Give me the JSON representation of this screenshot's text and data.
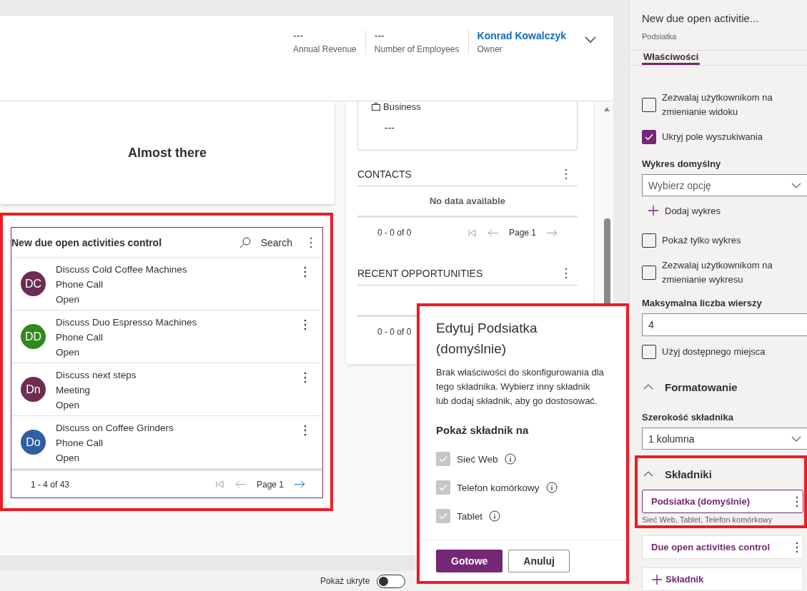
{
  "header": {
    "fields": [
      {
        "value": "---",
        "label": "Annual Revenue",
        "kind": "text"
      },
      {
        "value": "---",
        "label": "Number of Employees",
        "kind": "text"
      },
      {
        "value": "Konrad Kowalczyk",
        "label": "Owner",
        "kind": "link"
      }
    ]
  },
  "left_card": {
    "title": "Almost there"
  },
  "subgrid": {
    "title": "New due open activities control",
    "search_label": "Search",
    "rows": [
      {
        "initials": "DC",
        "color": "#6b2d52",
        "title": "Discuss Cold Coffee Machines",
        "type": "Phone Call",
        "status": "Open"
      },
      {
        "initials": "DD",
        "color": "#2f8a1d",
        "title": "Discuss Duo Espresso Machines",
        "type": "Phone Call",
        "status": "Open"
      },
      {
        "initials": "Dn",
        "color": "#6b2d52",
        "title": "Discuss next steps",
        "type": "Meeting",
        "status": "Open"
      },
      {
        "initials": "Do",
        "color": "#2e5fa3",
        "title": "Discuss on Coffee Grinders",
        "type": "Phone Call",
        "status": "Open"
      }
    ],
    "record_count": "1 - 4 of 43",
    "page": "Page 1"
  },
  "business_card": {
    "label": "Business",
    "value": "---"
  },
  "contacts": {
    "title": "CONTACTS",
    "empty_text": "No data available",
    "record_count": "0 - 0 of 0",
    "page": "Page 1"
  },
  "recent_opportunities": {
    "title": "RECENT OPPORTUNITIES",
    "record_count": "0 - 0 of 0"
  },
  "footer": {
    "toggle_label": "Pokaż ukryte",
    "toggle_on": false
  },
  "dialog": {
    "title": "Edytuj Podsiatka (domyślnie)",
    "description": "Brak właściwości do skonfigurowania dla tego składnika. Wybierz inny składnik lub dodaj składnik, aby go dostosować.",
    "section": "Pokaż składnik na",
    "options": [
      {
        "label": "Sieć Web",
        "checked": true,
        "disabled": true
      },
      {
        "label": "Telefon komórkowy",
        "checked": true,
        "disabled": true
      },
      {
        "label": "Tablet",
        "checked": true,
        "disabled": true
      }
    ],
    "buttons": [
      {
        "label": "Gotowe",
        "kind": "primary"
      },
      {
        "label": "Anuluj",
        "kind": "secondary"
      }
    ]
  },
  "panel": {
    "title": "New due open activitie...",
    "subtitle": "Podsiatka",
    "tabs": [
      {
        "label": "Właściwości",
        "selected": true
      }
    ],
    "settings": [
      {
        "kind": "checkbox",
        "label": "Zezwalaj użytkownikom na zmienianie widoku",
        "checked": false
      },
      {
        "kind": "checkbox",
        "label": "Ukryj pole wyszukiwania",
        "checked": true
      },
      {
        "kind": "select",
        "label": "Wykres domyślny",
        "placeholder": "Wybierz opcję"
      },
      {
        "kind": "add",
        "label": "Dodaj wykres"
      },
      {
        "kind": "checkbox",
        "label": "Pokaż tylko wykres",
        "checked": false
      },
      {
        "kind": "checkbox",
        "label": "Zezwalaj użytkownikom na zmienianie wykresu",
        "checked": false
      },
      {
        "kind": "input",
        "label": "Maksymalna liczba wierszy",
        "value": "4"
      },
      {
        "kind": "checkbox",
        "label": "Użyj dostępnego miejsca",
        "checked": false
      },
      {
        "kind": "section",
        "label": "Formatowanie",
        "expanded": true
      },
      {
        "kind": "select",
        "label": "Szerokość składnika",
        "value": "1 kolumna"
      }
    ],
    "components_section": {
      "label": "Składniki",
      "expanded": true
    },
    "components": [
      {
        "name": "Podsiatka (domyślnie)",
        "selected": true,
        "caption": "Sieć Web, Tablet, Telefon komórkowy"
      },
      {
        "name": "Due open activities control",
        "selected": false
      }
    ],
    "add_component": "Składnik"
  }
}
